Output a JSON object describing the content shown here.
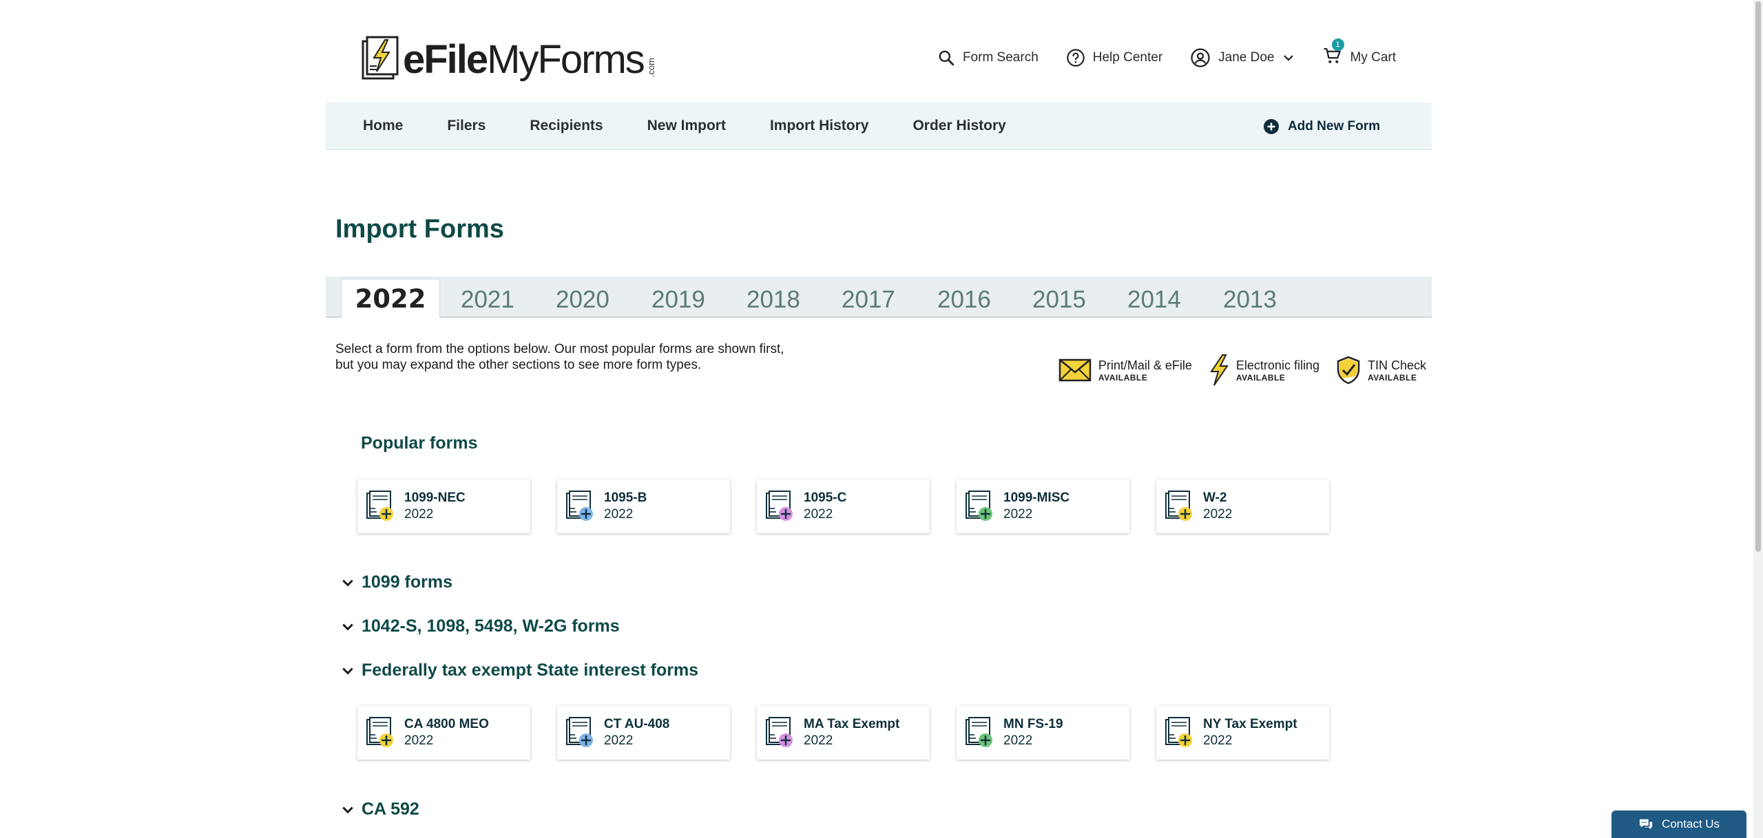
{
  "brand": {
    "name_bold": "eFile",
    "name_regular": "MyForms",
    "suffix": ".com"
  },
  "header": {
    "form_search": "Form Search",
    "help_center": "Help Center",
    "user_name": "Jane Doe",
    "cart_label": "My Cart",
    "cart_count": "1"
  },
  "nav": {
    "items": [
      "Home",
      "Filers",
      "Recipients",
      "New Import",
      "Import History",
      "Order History"
    ],
    "add_new_form": "Add New Form"
  },
  "page_title": "Import Forms",
  "years": {
    "active": "2022",
    "others": [
      "2021",
      "2020",
      "2019",
      "2018",
      "2017",
      "2016",
      "2015",
      "2014",
      "2013"
    ]
  },
  "intro": {
    "line1": "Select a form from the options below. Our most popular forms are shown first,",
    "line2": "but you may expand the other sections to see more form types."
  },
  "legend": [
    {
      "label": "Print/Mail & eFile",
      "status": "AVAILABLE",
      "icon": "envelope-icon"
    },
    {
      "label": "Electronic filing",
      "status": "AVAILABLE",
      "icon": "lightning-icon"
    },
    {
      "label": "TIN Check",
      "status": "AVAILABLE",
      "icon": "shield-check-icon"
    }
  ],
  "popular": {
    "title": "Popular forms",
    "forms": [
      {
        "name": "1099-NEC",
        "year": "2022",
        "accent": "#f2d13a"
      },
      {
        "name": "1095-B",
        "year": "2022",
        "accent": "#7fb3e8"
      },
      {
        "name": "1095-C",
        "year": "2022",
        "accent": "#d58fe0"
      },
      {
        "name": "1099-MISC",
        "year": "2022",
        "accent": "#6cc47a"
      },
      {
        "name": "W-2",
        "year": "2022",
        "accent": "#f2d13a"
      }
    ]
  },
  "sections": {
    "s1099": "1099 forms",
    "s1042": "1042-S, 1098, 5498, W-2G forms",
    "sexempt": "Federally tax exempt State interest forms",
    "sca592": "CA 592"
  },
  "exempt_forms": [
    {
      "name": "CA 4800 MEO",
      "year": "2022",
      "accent": "#f2d13a"
    },
    {
      "name": "CT AU-408",
      "year": "2022",
      "accent": "#7fb3e8"
    },
    {
      "name": "MA Tax Exempt",
      "year": "2022",
      "accent": "#d58fe0"
    },
    {
      "name": "MN FS-19",
      "year": "2022",
      "accent": "#6cc47a"
    },
    {
      "name": "NY Tax Exempt",
      "year": "2022",
      "accent": "#f2d13a"
    }
  ],
  "contact": "Contact Us"
}
